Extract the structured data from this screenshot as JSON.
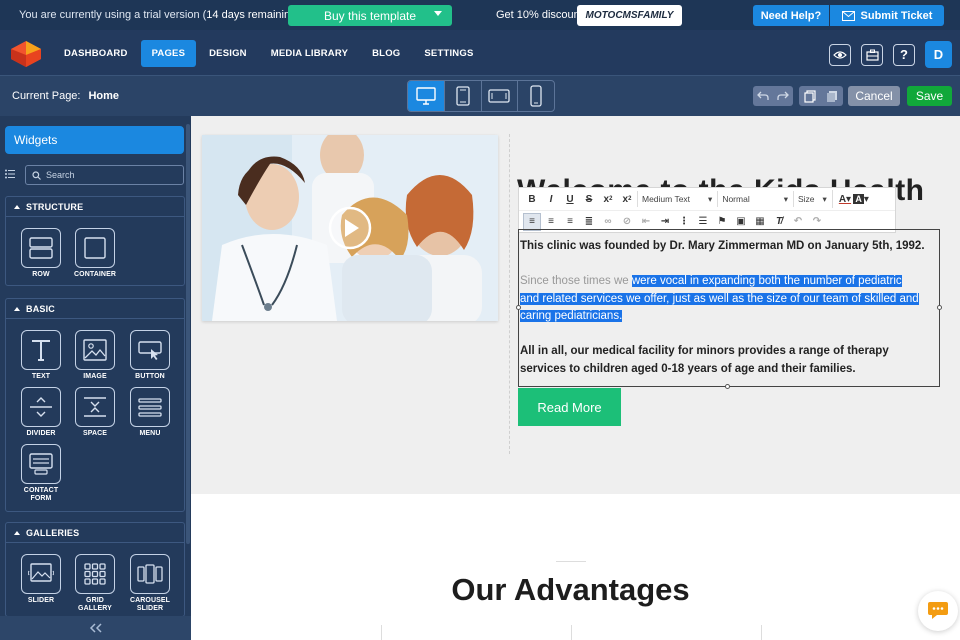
{
  "trial": {
    "message_prefix": "You are currently using a trial version (",
    "message_days": "14 days remaining",
    "message_suffix": ").",
    "buy_label": "Buy this template",
    "discount_label": "Get 10% discount",
    "promo_code": "MOTOCMSFAMILY",
    "help_label": "Need Help?",
    "ticket_label": "Submit Ticket"
  },
  "nav": {
    "items": [
      "DASHBOARD",
      "PAGES",
      "DESIGN",
      "MEDIA LIBRARY",
      "BLOG",
      "SETTINGS"
    ],
    "active": "PAGES",
    "avatar_letter": "D",
    "icons": [
      "eye-icon",
      "briefcase-icon",
      "help-icon"
    ]
  },
  "toolbar": {
    "current_page_label": "Current Page:",
    "current_page_value": "Home",
    "devices": [
      "desktop-icon",
      "tablet-icon",
      "tablet-landscape-icon",
      "mobile-icon"
    ],
    "active_device": "desktop-icon",
    "cancel_label": "Cancel",
    "save_label": "Save"
  },
  "sidebar": {
    "tab_label": "Widgets",
    "search_placeholder": "Search",
    "sections": [
      {
        "title": "STRUCTURE",
        "items": [
          "ROW",
          "CONTAINER"
        ]
      },
      {
        "title": "BASIC",
        "items": [
          "TEXT",
          "IMAGE",
          "BUTTON",
          "DIVIDER",
          "SPACE",
          "MENU",
          "CONTACT FORM"
        ]
      },
      {
        "title": "GALLERIES",
        "items": [
          "SLIDER",
          "GRID GALLERY",
          "CAROUSEL SLIDER"
        ]
      }
    ]
  },
  "editor": {
    "heading": "Welcome to the Kids Health",
    "format_select": "Medium Text",
    "style_select": "Normal",
    "size_select": "Size",
    "paragraph1": "This clinic was founded by Dr. Mary Zimmerman MD on January 5th, 1992.",
    "paragraph2_plain": "Since those times we ",
    "paragraph2_selected_a": "were vocal in expanding both the number of pediatric",
    "paragraph2_selected_b": "and related services we offer, just as well as the size of our team of skilled and",
    "paragraph2_selected_c": "caring pediatricians.",
    "paragraph3_a": "All in all, our medical facility for minors provides a range of therapy",
    "paragraph3_b": "services to children aged 0-18 years of age and their families.",
    "button_label": "Read More"
  },
  "section2": {
    "title": "Our Advantages"
  },
  "colors": {
    "accent_blue": "#1b88e0",
    "buy_green": "#22c08a",
    "save_green": "#11a83a",
    "read_more_green": "#1cbf78",
    "nav_bg": "#233a5e",
    "chat_orange": "#f39c12"
  }
}
